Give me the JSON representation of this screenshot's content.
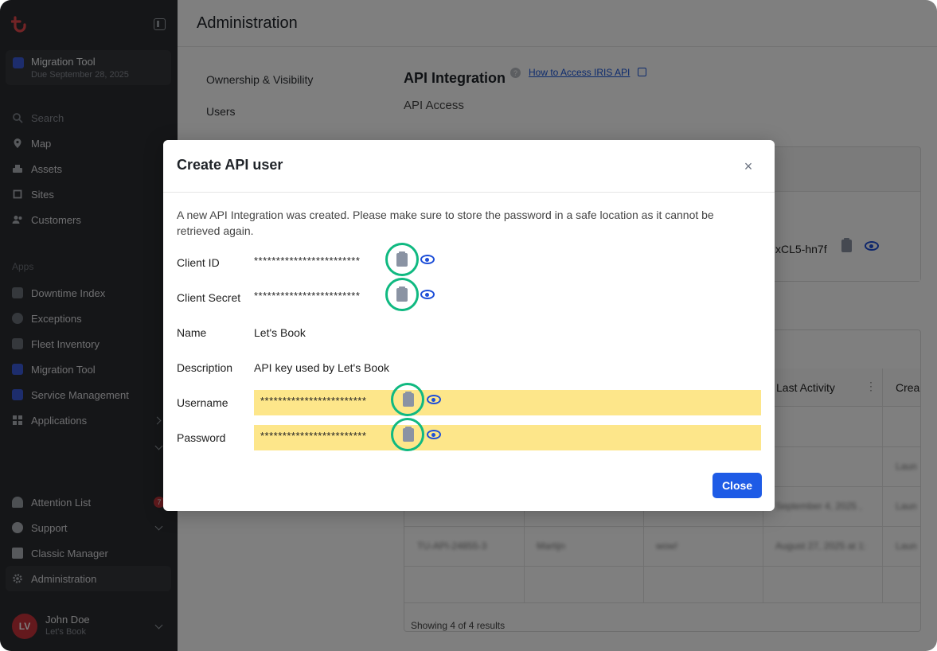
{
  "sidebar": {
    "project": {
      "title": "Migration Tool",
      "due": "Due September 28, 2025"
    },
    "nav": [
      {
        "label": "Search",
        "icon": "search-icon"
      },
      {
        "label": "Map",
        "icon": "map-pin-icon"
      },
      {
        "label": "Assets",
        "icon": "assets-icon"
      },
      {
        "label": "Sites",
        "icon": "sites-icon"
      },
      {
        "label": "Customers",
        "icon": "customers-icon"
      }
    ],
    "apps_label": "Apps",
    "apps": [
      {
        "label": "Downtime Index",
        "icon": "downtime-icon"
      },
      {
        "label": "Exceptions",
        "icon": "exceptions-icon"
      },
      {
        "label": "Fleet Inventory",
        "icon": "fleet-icon"
      },
      {
        "label": "Migration Tool",
        "icon": "migration-icon"
      },
      {
        "label": "Service Management",
        "icon": "wrench-icon"
      },
      {
        "label": "Applications",
        "icon": "grid-icon"
      }
    ],
    "bottom": [
      {
        "label": "Attention List",
        "icon": "bell-icon"
      },
      {
        "label": "Support",
        "icon": "help-icon"
      },
      {
        "label": "Classic Manager",
        "icon": "classic-icon"
      },
      {
        "label": "Administration",
        "icon": "gear-icon"
      }
    ],
    "attention_badge": "7",
    "user": {
      "initials": "LV",
      "name": "John Doe",
      "org": "Let's Book"
    }
  },
  "main": {
    "title": "Administration",
    "subnav": [
      "Ownership & Visibility",
      "Users"
    ],
    "section_title": "API Integration",
    "help_link": "How to Access IRIS API",
    "api_access": "API Access",
    "token_partial": "xCL5-hn7f",
    "table_headers": [
      "Last Activity",
      "Crea"
    ],
    "footer": "Showing 4 of 4 results",
    "blurred_rows": [
      {
        "id": "TU-API-24855-3",
        "user": "Martijn",
        "type": "wow!",
        "date": "August 27, 2025 at 1:",
        "creator": "Laun"
      },
      {
        "date": "September 4, 2025 ,",
        "creator": "Laun"
      }
    ]
  },
  "modal": {
    "title": "Create API user",
    "close_icon": "×",
    "message": "A new API Integration was created. Please make sure to store the password in a safe location as it cannot be retrieved again.",
    "fields": {
      "client_id": {
        "label": "Client ID",
        "value": "************************"
      },
      "client_secret": {
        "label": "Client Secret",
        "value": "************************"
      },
      "name": {
        "label": "Name",
        "value": "Let's Book"
      },
      "description": {
        "label": "Description",
        "value": "API key used by Let's Book"
      },
      "username": {
        "label": "Username",
        "value": "************************"
      },
      "password": {
        "label": "Password",
        "value": "************************"
      }
    },
    "close_button": "Close"
  },
  "colors": {
    "primary": "#1e5be6",
    "highlight": "#fde68a",
    "ring": "#10b981",
    "sidebar": "#2b2d31"
  }
}
